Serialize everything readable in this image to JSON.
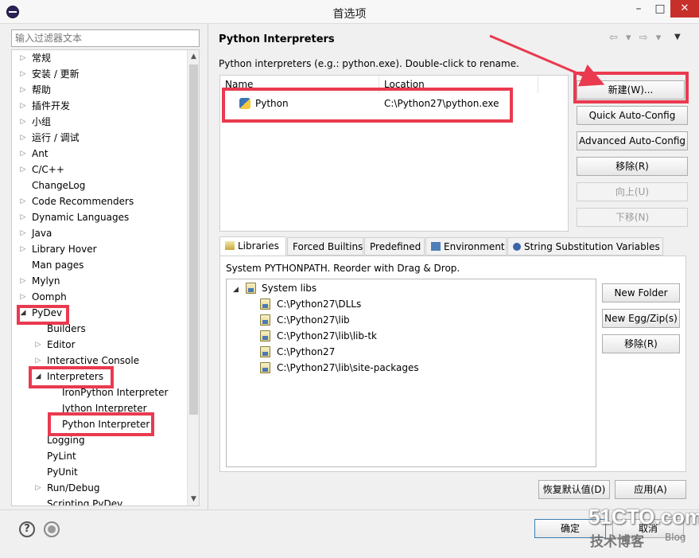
{
  "window": {
    "title": "首选项",
    "minimize": "–",
    "maximize": "□",
    "close": "✕"
  },
  "filter": {
    "placeholder": "输入过滤器文本"
  },
  "tree": {
    "items": [
      {
        "label": "常规",
        "arrow": "▷"
      },
      {
        "label": "安装 / 更新",
        "arrow": "▷"
      },
      {
        "label": "帮助",
        "arrow": "▷"
      },
      {
        "label": "插件开发",
        "arrow": "▷"
      },
      {
        "label": "小组",
        "arrow": "▷"
      },
      {
        "label": "运行 / 调试",
        "arrow": "▷"
      },
      {
        "label": "Ant",
        "arrow": "▷"
      },
      {
        "label": "C/C++",
        "arrow": "▷"
      },
      {
        "label": "ChangeLog",
        "arrow": ""
      },
      {
        "label": "Code Recommenders",
        "arrow": "▷"
      },
      {
        "label": "Dynamic Languages",
        "arrow": "▷"
      },
      {
        "label": "Java",
        "arrow": "▷"
      },
      {
        "label": "Library Hover",
        "arrow": "▷"
      },
      {
        "label": "Man pages",
        "arrow": ""
      },
      {
        "label": "Mylyn",
        "arrow": "▷"
      },
      {
        "label": "Oomph",
        "arrow": "▷"
      },
      {
        "label": "PyDev",
        "arrow": "◢"
      },
      {
        "label": "Builders",
        "arrow": ""
      },
      {
        "label": "Editor",
        "arrow": "▷"
      },
      {
        "label": "Interactive Console",
        "arrow": "▷"
      },
      {
        "label": "Interpreters",
        "arrow": "◢"
      },
      {
        "label": "IronPython Interpreter",
        "arrow": ""
      },
      {
        "label": "Jython Interpreter",
        "arrow": ""
      },
      {
        "label": "Python Interpreter",
        "arrow": ""
      },
      {
        "label": "Logging",
        "arrow": ""
      },
      {
        "label": "PyLint",
        "arrow": ""
      },
      {
        "label": "PyUnit",
        "arrow": ""
      },
      {
        "label": "Run/Debug",
        "arrow": "▷"
      },
      {
        "label": "Scripting PyDev",
        "arrow": ""
      }
    ],
    "scroll_up": "▲",
    "scroll_down": "▼"
  },
  "page": {
    "title": "Python Interpreters",
    "nav_back": "⇦ ▾",
    "nav_forward": "⇨ ▾",
    "nav_menu": "▼",
    "description": "Python interpreters (e.g.: python.exe).   Double-click to rename."
  },
  "interpreters": {
    "columns": [
      "Name",
      "Location"
    ],
    "rows": [
      {
        "name": "Python",
        "location": "C:\\Python27\\python.exe"
      }
    ]
  },
  "side_buttons": {
    "new": "新建(W)...",
    "quick": "Quick Auto-Config",
    "advanced": "Advanced Auto-Config",
    "remove": "移除(R)",
    "up": "向上(U)",
    "down": "下移(N)"
  },
  "tabs": [
    "Libraries",
    "Forced Builtins",
    "Predefined",
    "Environment",
    "String Substitution Variables"
  ],
  "libraries": {
    "description": "System PYTHONPATH.   Reorder with Drag & Drop.",
    "root": "System libs",
    "root_arrow": "◢",
    "paths": [
      "C:\\Python27\\DLLs",
      "C:\\Python27\\lib",
      "C:\\Python27\\lib\\lib-tk",
      "C:\\Python27",
      "C:\\Python27\\lib\\site-packages"
    ],
    "new_folder": "New Folder",
    "new_egg": "New Egg/Zip(s)",
    "remove": "移除(R)"
  },
  "footer": {
    "restore_defaults": "恢复默认值(D)",
    "apply": "应用(A)",
    "ok": "确定",
    "cancel": "取消",
    "help": "?"
  },
  "watermark": {
    "main": "51CTO.com",
    "sub": "技术博客",
    "blog": "Blog"
  },
  "colors": {
    "highlight": "#e93a4f",
    "close_button": "#c7302a"
  }
}
